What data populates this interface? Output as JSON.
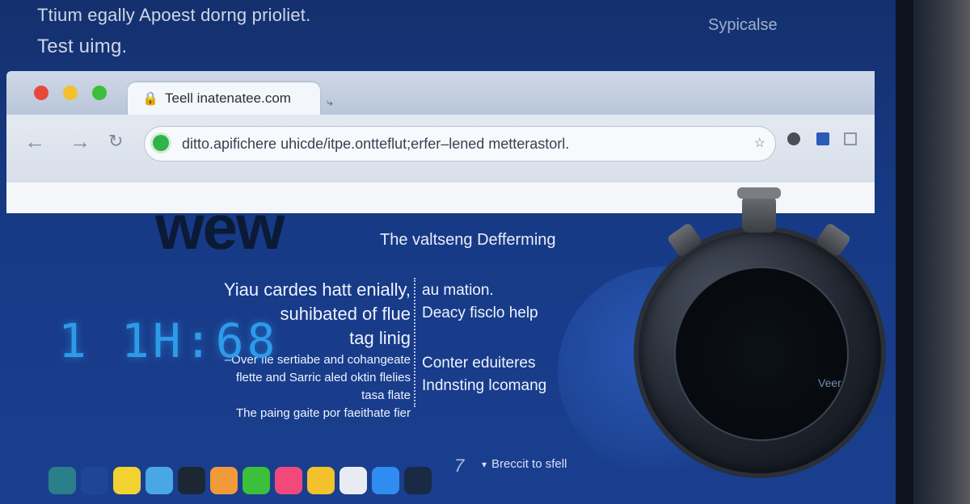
{
  "desktop": {
    "header_line1": "Ttium egally Apoest dorng prioliet.",
    "header_line2": "Test uimg.",
    "brand": "Sypicalse"
  },
  "browser": {
    "tab_title": "Teell inatenatee.com",
    "url": "ditto.apifichere uhicde/itpe.ontteflut;erfer–lened metterastorl."
  },
  "page": {
    "hero_word": "wew",
    "subhead": "The valtseng Defferming",
    "left": {
      "line1": "Yiau cardes hatt enially,",
      "line2": "suhibated of flue",
      "line3": "tag linig",
      "small1": "–Over fle sertiabe and cohangeate",
      "small2": "flette and Sarric aled oktin flelies",
      "small3": "tasa flate",
      "small4": "The paing gaite por faeithate fier"
    },
    "right": {
      "line1": "au mation.",
      "line2": "Deacy fisclo help",
      "line3": "Conter eduiteres",
      "line4": "Indnsting lcomang"
    }
  },
  "stopwatch": {
    "digits": "1 1H:68",
    "sub_label": "Veer"
  },
  "dock": {
    "label": "Breccit to sfell",
    "seven": "7",
    "items": [
      {
        "icon": "accessibility-icon",
        "color": "#2a7f8a"
      },
      {
        "icon": "pen-icon",
        "color": "#1e4596"
      },
      {
        "icon": "notes-icon",
        "color": "#f1d230"
      },
      {
        "icon": "cloud-icon",
        "color": "#4aa7e6"
      },
      {
        "icon": "terminal-icon",
        "color": "#1d2733"
      },
      {
        "icon": "photos-icon",
        "color": "#f09a3a"
      },
      {
        "icon": "chrome-icon",
        "color": "#3cbf3b"
      },
      {
        "icon": "music-icon",
        "color": "#f2497a"
      },
      {
        "icon": "maps-icon",
        "color": "#f2c12c"
      },
      {
        "icon": "calendar-icon",
        "color": "#e8ecf2"
      },
      {
        "icon": "finder-icon",
        "color": "#2f8cf0"
      },
      {
        "icon": "list-icon",
        "color": "#1a2a44"
      }
    ]
  }
}
